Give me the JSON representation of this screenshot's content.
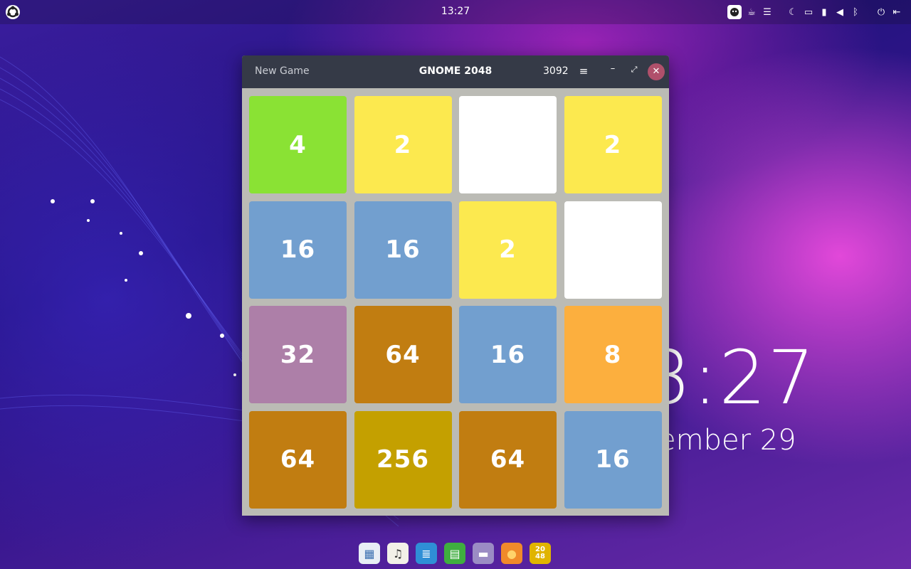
{
  "topbar": {
    "clock": "13:27",
    "icons": [
      "face-icon",
      "coffee-icon",
      "list-icon",
      "moon-icon",
      "folder-icon",
      "battery-icon",
      "volume-icon",
      "bluetooth-icon",
      "power-icon",
      "logout-icon"
    ]
  },
  "desktop": {
    "time": "3:27",
    "date": "ember 29"
  },
  "window": {
    "new_game": "New Game",
    "title": "GNOME 2048",
    "score": "3092",
    "menu_glyph": "≡",
    "minimize_glyph": "–",
    "maximize_glyph": "⤢",
    "close_glyph": "✕"
  },
  "board": {
    "tiles": [
      {
        "value": "4",
        "color": "#8ae234"
      },
      {
        "value": "2",
        "color": "#fce94f"
      },
      {
        "value": "",
        "color": "#ffffff"
      },
      {
        "value": "2",
        "color": "#fce94f"
      },
      {
        "value": "16",
        "color": "#729fcf"
      },
      {
        "value": "16",
        "color": "#729fcf"
      },
      {
        "value": "2",
        "color": "#fce94f"
      },
      {
        "value": "",
        "color": "#ffffff"
      },
      {
        "value": "32",
        "color": "#ad7fa8"
      },
      {
        "value": "64",
        "color": "#c17d11"
      },
      {
        "value": "16",
        "color": "#729fcf"
      },
      {
        "value": "8",
        "color": "#fcaf3e"
      },
      {
        "value": "64",
        "color": "#c17d11"
      },
      {
        "value": "256",
        "color": "#c4a000"
      },
      {
        "value": "64",
        "color": "#c17d11"
      },
      {
        "value": "16",
        "color": "#729fcf"
      }
    ]
  },
  "dock": {
    "apps": [
      {
        "name": "app-grid-icon",
        "color": "#e8eef5",
        "glyph": "▦",
        "fg": "#3a6fb0"
      },
      {
        "name": "music-icon",
        "color": "#f2f0e8",
        "glyph": "♫",
        "fg": "#333333"
      },
      {
        "name": "text-editor-icon",
        "color": "#2f8fd6",
        "glyph": "≣",
        "fg": "#ffffff"
      },
      {
        "name": "spreadsheet-icon",
        "color": "#3fae3f",
        "glyph": "▤",
        "fg": "#ffffff"
      },
      {
        "name": "files-icon",
        "color": "#9b8cc4",
        "glyph": "▬",
        "fg": "#ffffff"
      },
      {
        "name": "firefox-icon",
        "color": "#f08a2a",
        "glyph": "●",
        "fg": "#ffd36b"
      },
      {
        "name": "2048-icon",
        "color": "#e0b400",
        "glyph": "",
        "fg": "#ffffff"
      }
    ],
    "icon_2048_label": "20\n48"
  }
}
